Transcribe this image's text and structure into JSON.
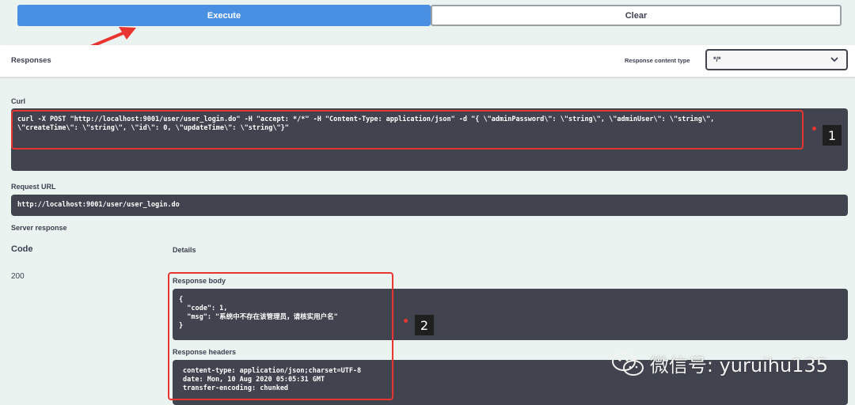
{
  "buttons": {
    "execute": "Execute",
    "clear": "Clear"
  },
  "responses": {
    "title": "Responses",
    "content_type_label": "Response content type",
    "content_type_value": "*/*"
  },
  "curl": {
    "label": "Curl",
    "lines": [
      "curl -X POST \"http://localhost:9001/user/user_login.do\" -H \"accept: */*\" -H \"Content-Type: application/json\" -d \"{ \\\"adminPassword\\\": \\\"string\\\", \\\"adminUser\\\": \\\"string\\\",",
      "\\\"createTime\\\": \\\"string\\\", \\\"id\\\": 0, \\\"updateTime\\\": \\\"string\\\"}\""
    ]
  },
  "request_url": {
    "label": "Request URL",
    "value": "http://localhost:9001/user/user_login.do"
  },
  "server_response": {
    "label": "Server response",
    "code_header": "Code",
    "details_header": "Details",
    "status_code": "200",
    "body_label": "Response body",
    "body_lines": [
      "{",
      "  \"code\": 1,",
      "  \"msg\": \"系统中不存在该管理员，请核实用户名\"",
      "}"
    ],
    "headers_label": "Response headers",
    "header_lines": [
      "content-type: application/json;charset=UTF-8",
      "date: Mon, 10 Aug 2020 05:05:31 GMT",
      "transfer-encoding: chunked"
    ]
  },
  "annotations": {
    "badge1": "1",
    "badge2": "2",
    "color": "#e8352f"
  },
  "watermark": {
    "text": "微信号: yuruihu135",
    "icon": "wechat-icon"
  },
  "colors": {
    "execute": "#4990e2",
    "dark_box": "#41444e",
    "background": "#ebf3f1"
  }
}
